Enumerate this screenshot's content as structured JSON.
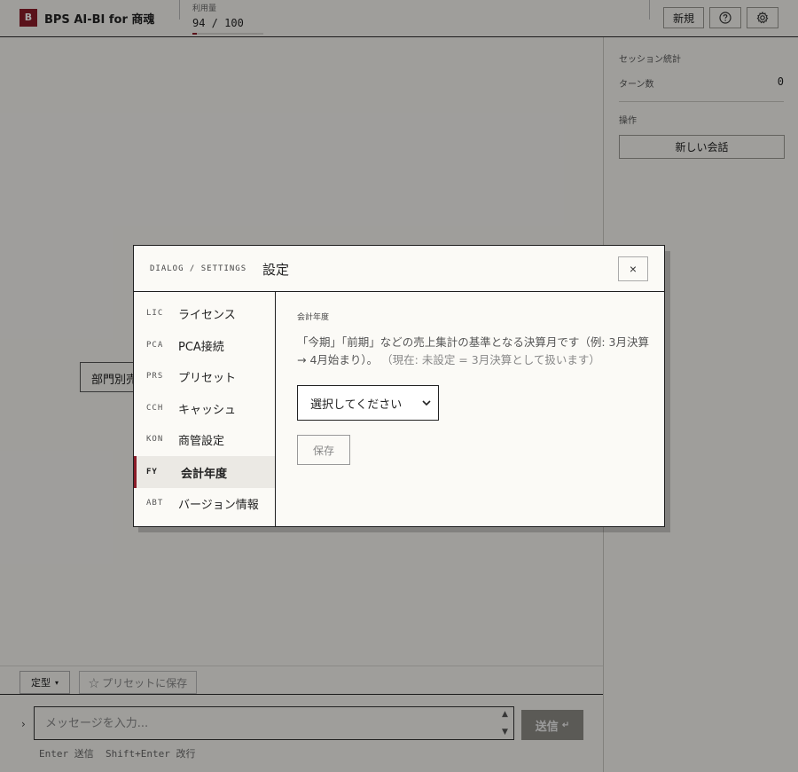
{
  "header": {
    "logo_letter": "B",
    "app_title": "BPS AI-BI for 商魂",
    "usage_label": "利用量",
    "usage_value": "94 / 100",
    "usage_fraction": 0.06,
    "new_button": "新規",
    "help_icon": "question-circle-icon",
    "settings_icon": "gear-icon"
  },
  "colors": {
    "accent": "#8a1c28",
    "background": "#f4f3ef",
    "overlay": "rgba(0,0,0,0.35)"
  },
  "right_panel": {
    "session_title": "セッション統計",
    "turn_label": "ターン数",
    "turn_value": "0",
    "ops_label": "操作",
    "new_chat_button": "新しい会話"
  },
  "chat": {
    "bubble_text": "部門別売"
  },
  "preset_bar": {
    "fixed_label": "定型",
    "fixed_caret": "▾",
    "save_preset_label": "☆ プリセットに保存"
  },
  "input": {
    "prompt_symbol": "›",
    "placeholder": "メッセージを入力...",
    "send_label": "送信",
    "send_icon": "↵",
    "hint": "Enter 送信  Shift+Enter 改行"
  },
  "dialog": {
    "breadcrumb": "DIALOG / SETTINGS",
    "title": "設定",
    "close": "×",
    "nav": [
      {
        "code": "LIC",
        "label": "ライセンス"
      },
      {
        "code": "PCA",
        "label": "PCA接続"
      },
      {
        "code": "PRS",
        "label": "プリセット"
      },
      {
        "code": "CCH",
        "label": "キャッシュ"
      },
      {
        "code": "KON",
        "label": "商管設定"
      },
      {
        "code": "FY",
        "label": "会計年度"
      },
      {
        "code": "ABT",
        "label": "バージョン情報"
      }
    ],
    "active_nav": "FY",
    "section_label": "会計年度",
    "description": "「今期」「前期」などの売上集計の基準となる決算月です（例: 3月決算 → 4月始まり）。",
    "description_note": "（現在: 未設定 = 3月決算として扱います）",
    "select_value": "選択してください",
    "select_caret": "⌄",
    "save_button": "保存"
  }
}
